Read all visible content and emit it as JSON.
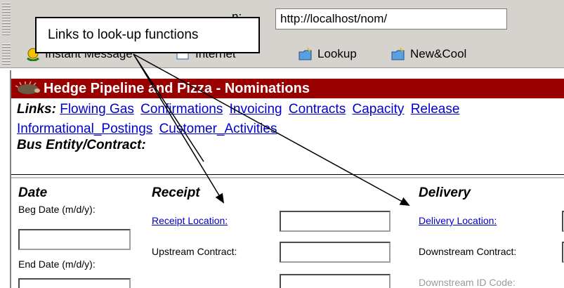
{
  "browser": {
    "address_label": "n:",
    "url": "http://localhost/nom/",
    "links_bar": [
      {
        "label": "Instant Message",
        "icon": "instant-message-icon"
      },
      {
        "label": "Internet",
        "icon": "internet-icon"
      },
      {
        "label": "Lookup",
        "icon": "folder-icon"
      },
      {
        "label": "New&Cool",
        "icon": "folder-icon"
      }
    ]
  },
  "page": {
    "title": "Hedge Pipeline and Pizza - Nominations",
    "links_heading": "Links:",
    "links": [
      "Flowing Gas",
      "Confirmations",
      "Invoicing",
      "Contracts",
      "Capacity",
      "Release",
      "Informational_Postings",
      "Customer_Activities"
    ],
    "bus_entity_label": "Bus Entity/Contract:"
  },
  "form": {
    "date_header": "Date",
    "receipt_header": "Receipt",
    "delivery_header": "Delivery",
    "beg_date_label": "Beg Date (m/d/y):",
    "end_date_label": "End Date (m/d/y):",
    "receipt_location_link": "Receipt Location:",
    "upstream_contract_label": "Upstream Contract:",
    "delivery_location_link": "Delivery Location:",
    "downstream_contract_label": "Downstream Contract:",
    "downstream_id_label": "Downstream ID Code:"
  },
  "callout": {
    "text": "Links to look-up functions"
  }
}
